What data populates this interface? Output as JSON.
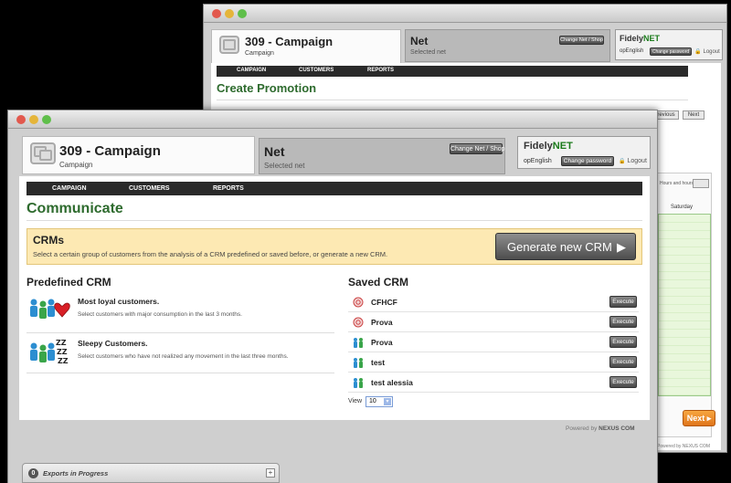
{
  "back_window": {
    "campaign_title": "309 - Campaign",
    "campaign_sub": "Campaign",
    "net_title": "Net",
    "net_sub": "Selected net",
    "change_btn": "Change Net / Shop",
    "fidely_brand": "Fidely",
    "fidely_brand_accent": "NET",
    "lang": "opEnglish",
    "change_password": "Change password",
    "logout": "Logout",
    "nav": [
      "CAMPAIGN",
      "CUSTOMERS",
      "REPORTS"
    ],
    "page_title": "Create Promotion",
    "previous": "Previous",
    "next_small": "Next",
    "day_label": "Saturday",
    "hours_label": "Hours and hours",
    "next_button": "Next ▸",
    "powered_by": "Powered by NEXUS COM"
  },
  "front_window": {
    "campaign_title": "309 - Campaign",
    "campaign_sub": "Campaign",
    "net_title": "Net",
    "net_sub": "Selected net",
    "change_btn": "Change Net / Shop",
    "fidely_brand": "Fidely",
    "fidely_brand_accent": "NET",
    "lang": "opEnglish",
    "change_password": "Change password",
    "logout": "Logout",
    "nav": [
      "CAMPAIGN",
      "CUSTOMERS",
      "REPORTS"
    ],
    "page_title": "Communicate",
    "crm_banner": {
      "title": "CRMs",
      "text": "Select a certain group of customers from the analysis of a CRM predefined or saved before, or generate a new CRM.",
      "button": "Generate new CRM",
      "button_icon": "▶"
    },
    "predefined": {
      "heading": "Predefined CRM",
      "items": [
        {
          "title": "Most loyal customers.",
          "desc": "Select customers with major consumption in the last 3 months."
        },
        {
          "title": "Sleepy Customers.",
          "desc": "Select customers who have not realized any movement in the last three months."
        }
      ]
    },
    "saved": {
      "heading": "Saved CRM",
      "items": [
        {
          "name": "CFHCF",
          "icon": "target-icon",
          "action": "Execute"
        },
        {
          "name": "Prova",
          "icon": "target-icon",
          "action": "Execute"
        },
        {
          "name": "Prova",
          "icon": "people-icon",
          "action": "Execute"
        },
        {
          "name": "test",
          "icon": "people-icon",
          "action": "Execute"
        },
        {
          "name": "test alessia",
          "icon": "people-icon",
          "action": "Execute"
        }
      ],
      "view_label": "View",
      "view_value": "10"
    },
    "powered_by": "Powered by",
    "powered_brand": "NEXUS COM"
  },
  "exports": {
    "count": "0",
    "label": "Exports in Progress",
    "toggle": "+"
  }
}
